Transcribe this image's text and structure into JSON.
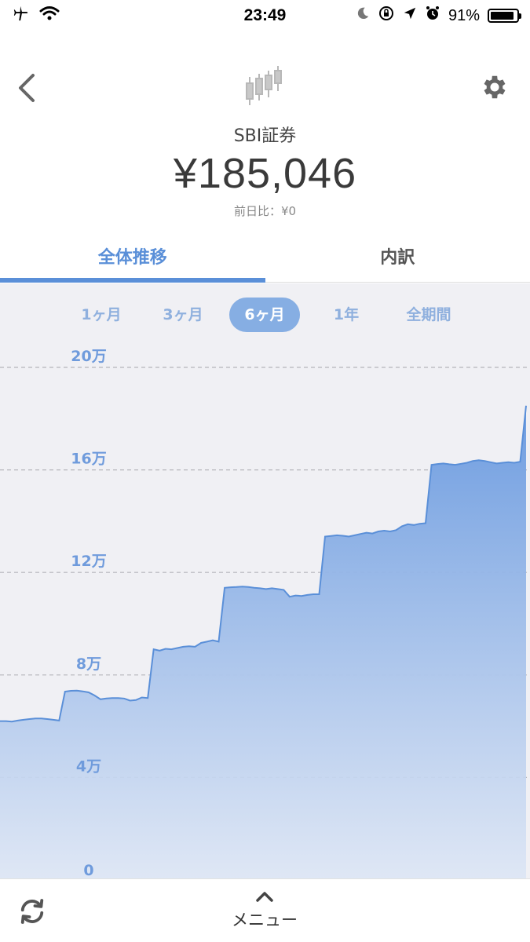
{
  "status": {
    "time": "23:49",
    "battery": "91%",
    "battery_level": 0.91
  },
  "header": {
    "account": "SBI証券",
    "total": "¥185,046",
    "day_change": "前日比：¥0"
  },
  "tabs": [
    {
      "label": "全体推移",
      "active": true
    },
    {
      "label": "内訳",
      "active": false
    }
  ],
  "periods": [
    {
      "label": "1ヶ月",
      "selected": false
    },
    {
      "label": "3ヶ月",
      "selected": false
    },
    {
      "label": "6ヶ月",
      "selected": true
    },
    {
      "label": "1年",
      "selected": false
    },
    {
      "label": "全期間",
      "selected": false
    }
  ],
  "chart_data": {
    "type": "area",
    "ylim": [
      0,
      200000
    ],
    "yticks": [
      {
        "value": 200000,
        "label": "20万"
      },
      {
        "value": 160000,
        "label": "16万"
      },
      {
        "value": 120000,
        "label": "12万"
      },
      {
        "value": 80000,
        "label": "8万"
      },
      {
        "value": 40000,
        "label": "4万"
      },
      {
        "value": 0,
        "label": "0"
      }
    ],
    "values": [
      62000,
      62000,
      61800,
      62200,
      62500,
      62800,
      63000,
      63000,
      62800,
      62500,
      62200,
      73500,
      73800,
      73900,
      73600,
      73200,
      72000,
      70500,
      70800,
      71000,
      71000,
      70800,
      70000,
      70200,
      71200,
      71000,
      90000,
      89500,
      90200,
      90000,
      90500,
      91000,
      91200,
      91000,
      92500,
      93000,
      93500,
      93000,
      114000,
      114200,
      114300,
      114500,
      114300,
      114000,
      113800,
      113500,
      113800,
      113500,
      113200,
      110500,
      111000,
      110800,
      111200,
      111500,
      111500,
      134000,
      134200,
      134500,
      134300,
      134000,
      134500,
      135000,
      135500,
      135200,
      136000,
      136300,
      136000,
      136500,
      138000,
      138800,
      138500,
      139000,
      139200,
      162000,
      162300,
      162500,
      162200,
      162000,
      162400,
      162800,
      163500,
      163800,
      163500,
      163000,
      162500,
      162800,
      163000,
      162800,
      163200,
      185046
    ],
    "color": "#5a8fd8"
  },
  "bottom": {
    "menu_label": "メニュー"
  }
}
